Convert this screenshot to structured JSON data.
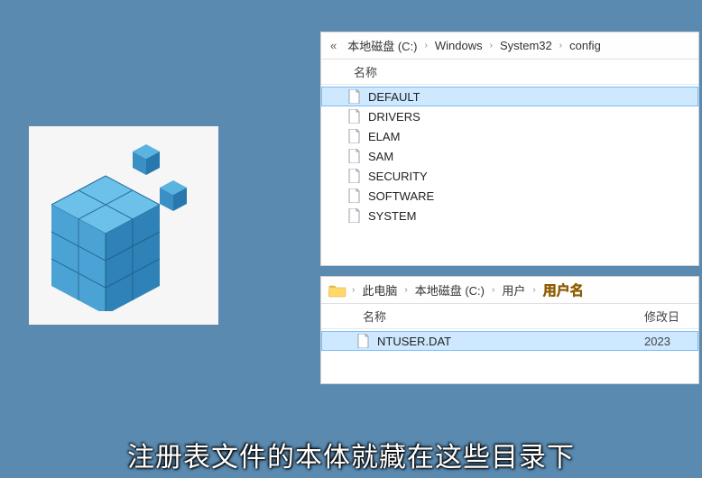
{
  "window1": {
    "breadcrumb": {
      "prefix": "«",
      "segments": [
        "本地磁盘 (C:)",
        "Windows",
        "System32",
        "config"
      ]
    },
    "columns": {
      "name": "名称"
    },
    "files": [
      {
        "name": "DEFAULT",
        "selected": true
      },
      {
        "name": "DRIVERS",
        "selected": false
      },
      {
        "name": "ELAM",
        "selected": false
      },
      {
        "name": "SAM",
        "selected": false
      },
      {
        "name": "SECURITY",
        "selected": false
      },
      {
        "name": "SOFTWARE",
        "selected": false
      },
      {
        "name": "SYSTEM",
        "selected": false
      }
    ]
  },
  "window2": {
    "breadcrumb": {
      "segments": [
        "此电脑",
        "本地磁盘 (C:)",
        "用户"
      ],
      "highlight": "用户名"
    },
    "columns": {
      "name": "名称",
      "date": "修改日"
    },
    "files": [
      {
        "name": "NTUSER.DAT",
        "date": "2023",
        "selected": true
      }
    ]
  },
  "caption": "注册表文件的本体就藏在这些目录下"
}
